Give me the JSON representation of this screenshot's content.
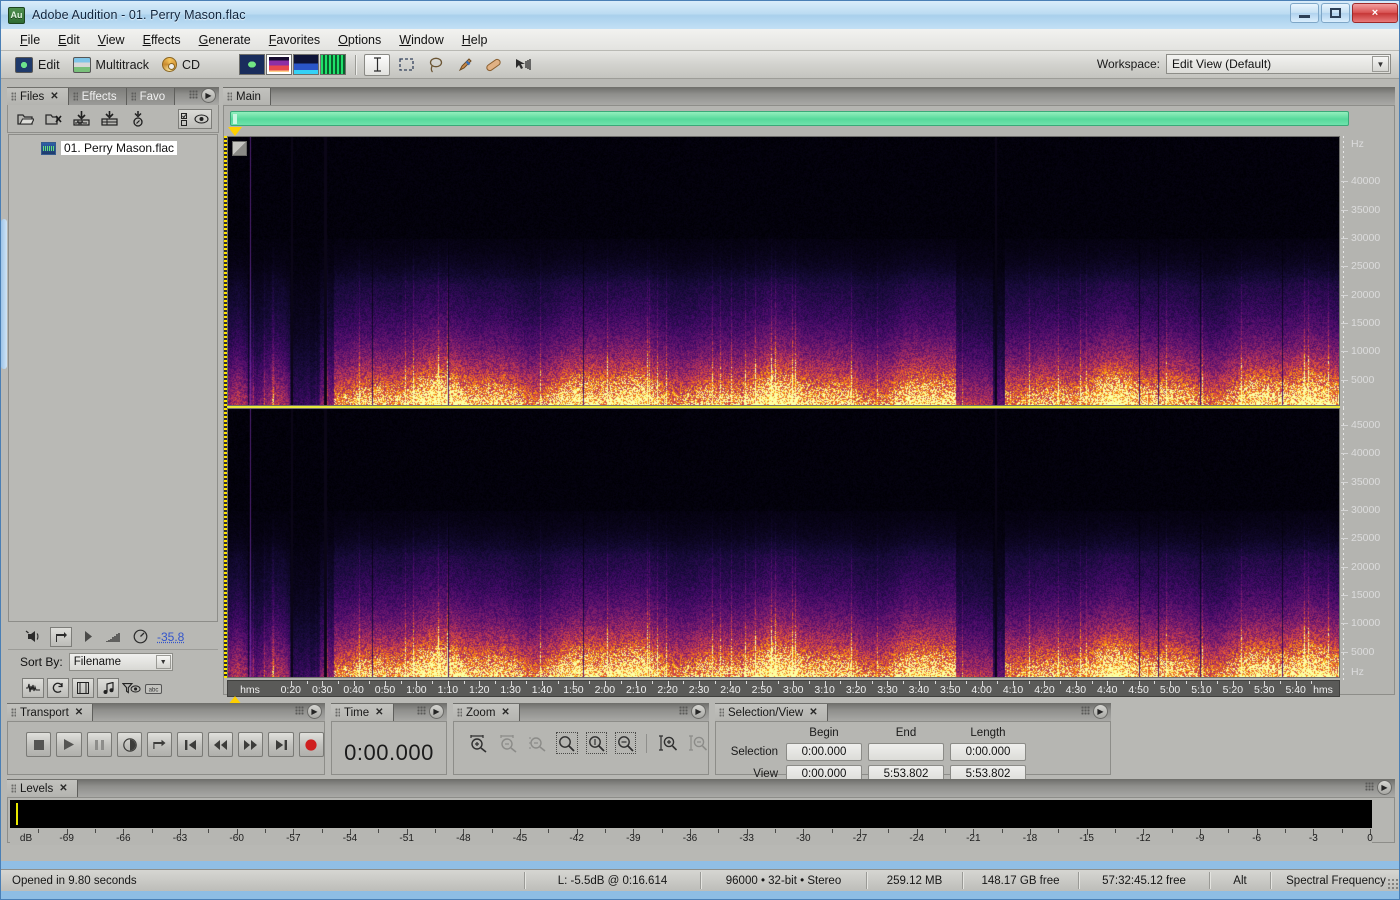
{
  "window": {
    "app_icon": "Au",
    "title": "Adobe Audition - 01. Perry Mason.flac",
    "minimize": "minimize-button",
    "maximize": "maximize-button",
    "close": "×"
  },
  "menubar": {
    "items": [
      "File",
      "Edit",
      "View",
      "Effects",
      "Generate",
      "Favorites",
      "Options",
      "Window",
      "Help"
    ]
  },
  "toolbar": {
    "modes": [
      {
        "label": "Edit",
        "icon": "waveform-icon"
      },
      {
        "label": "Multitrack",
        "icon": "multitrack-icon"
      },
      {
        "label": "CD",
        "icon": "cd-icon"
      }
    ],
    "view_buttons": [
      "waveform-view",
      "spectral-frequency-view",
      "spectral-pan-view",
      "spectral-phase-view"
    ],
    "active_view": "spectral-frequency-view",
    "tools": [
      "time-selection-tool",
      "marquee-selection-tool",
      "lasso-selection-tool",
      "paintbrush-selection-tool",
      "spot-healing-brush-tool",
      "effects-paintbrush-tool"
    ],
    "active_tool": "time-selection-tool",
    "workspace_label": "Workspace:",
    "workspace_value": "Edit View (Default)"
  },
  "files_panel": {
    "tabs": [
      {
        "label": "Files",
        "active": true,
        "closable": true
      },
      {
        "label": "Effects",
        "active": false,
        "closable": false
      },
      {
        "label": "Favo",
        "active": false,
        "closable": false
      }
    ],
    "toolbar_icons": [
      "open-file-icon",
      "close-file-icon",
      "insert-into-multitrack-icon",
      "insert-into-cd-list-icon",
      "show-file-info-icon",
      "show-options-icon"
    ],
    "files": [
      {
        "name": "01. Perry Mason.flac",
        "icon": "audio-file-icon",
        "selected": true
      }
    ],
    "transport_mini": {
      "level_value": "-35.8",
      "icons": [
        "mute-icon",
        "loop-play-icon",
        "play-icon",
        "volume-meter-icon",
        "knob-icon"
      ]
    },
    "sort_by_label": "Sort By:",
    "sort_by_value": "Filename",
    "bottom_icons": [
      "waveform-toggle-icon",
      "loop-toggle-icon",
      "video-toggle-icon",
      "midi-toggle-icon",
      "filter-icon",
      "advanced-options-icon"
    ]
  },
  "main_panel": {
    "tabs": [
      {
        "label": "Main",
        "active": true
      }
    ],
    "overview_bar": "green-overview-bar",
    "channels": [
      "left-channel-spectrogram",
      "right-channel-spectrogram"
    ],
    "frequency_unit": "Hz",
    "frequency_ticks_top": [
      "40000",
      "35000",
      "30000",
      "25000",
      "20000",
      "15000",
      "10000",
      "5000"
    ],
    "frequency_ticks_bottom": [
      "45000",
      "40000",
      "35000",
      "30000",
      "25000",
      "20000",
      "15000",
      "10000",
      "5000"
    ],
    "time_unit": "hms",
    "time_ticks": [
      "0:20",
      "0:30",
      "0:40",
      "0:50",
      "1:00",
      "1:10",
      "1:20",
      "1:30",
      "1:40",
      "1:50",
      "2:00",
      "2:10",
      "2:20",
      "2:30",
      "2:40",
      "2:50",
      "3:00",
      "3:10",
      "3:20",
      "3:30",
      "3:40",
      "3:50",
      "4:00",
      "4:10",
      "4:20",
      "4:30",
      "4:40",
      "4:50",
      "5:00",
      "5:10",
      "5:20",
      "5:30",
      "5:40"
    ]
  },
  "transport_panel": {
    "tab_label": "Transport",
    "buttons": [
      "stop-button",
      "play-button",
      "pause-button",
      "play-from-cursor-button",
      "loop-play-button",
      "go-to-beginning-button",
      "rewind-button",
      "fast-forward-button",
      "go-to-end-button",
      "record-button"
    ]
  },
  "time_panel": {
    "tab_label": "Time",
    "value": "0:00.000"
  },
  "zoom_panel": {
    "tab_label": "Zoom",
    "buttons": [
      "zoom-in-horizontal",
      "zoom-out-horizontal",
      "zoom-out-full-both-axes",
      "zoom-to-selection",
      "zoom-in-to-left-edge-of-selection",
      "zoom-in-to-right-edge-of-selection",
      "zoom-in-vertical",
      "zoom-out-vertical"
    ]
  },
  "selection_view_panel": {
    "tab_label": "Selection/View",
    "headers": [
      "Begin",
      "End",
      "Length"
    ],
    "rows": [
      {
        "label": "Selection",
        "begin": "0:00.000",
        "end": "",
        "length": "0:00.000"
      },
      {
        "label": "View",
        "begin": "0:00.000",
        "end": "5:53.802",
        "length": "5:53.802"
      }
    ]
  },
  "levels_panel": {
    "tab_label": "Levels",
    "unit": "dB",
    "ticks": [
      "-69",
      "-66",
      "-63",
      "-60",
      "-57",
      "-54",
      "-51",
      "-48",
      "-45",
      "-42",
      "-39",
      "-36",
      "-33",
      "-30",
      "-27",
      "-24",
      "-21",
      "-18",
      "-15",
      "-12",
      "-9",
      "-6",
      "-3",
      "0"
    ]
  },
  "statusbar": {
    "message": "Opened in 9.80 seconds",
    "cells": [
      "L: -5.5dB @  0:16.614",
      "96000 • 32-bit • Stereo",
      "259.12 MB",
      "148.17 GB free",
      "57:32:45.12 free",
      "Alt",
      "Spectral Frequency"
    ]
  },
  "colors": {
    "accent": "#3355cc",
    "overview_green": "#56d99b",
    "marker_yellow": "#ffd000",
    "record_red": "#cf1f1f",
    "titlebar_blue": "#a9d0ec"
  }
}
